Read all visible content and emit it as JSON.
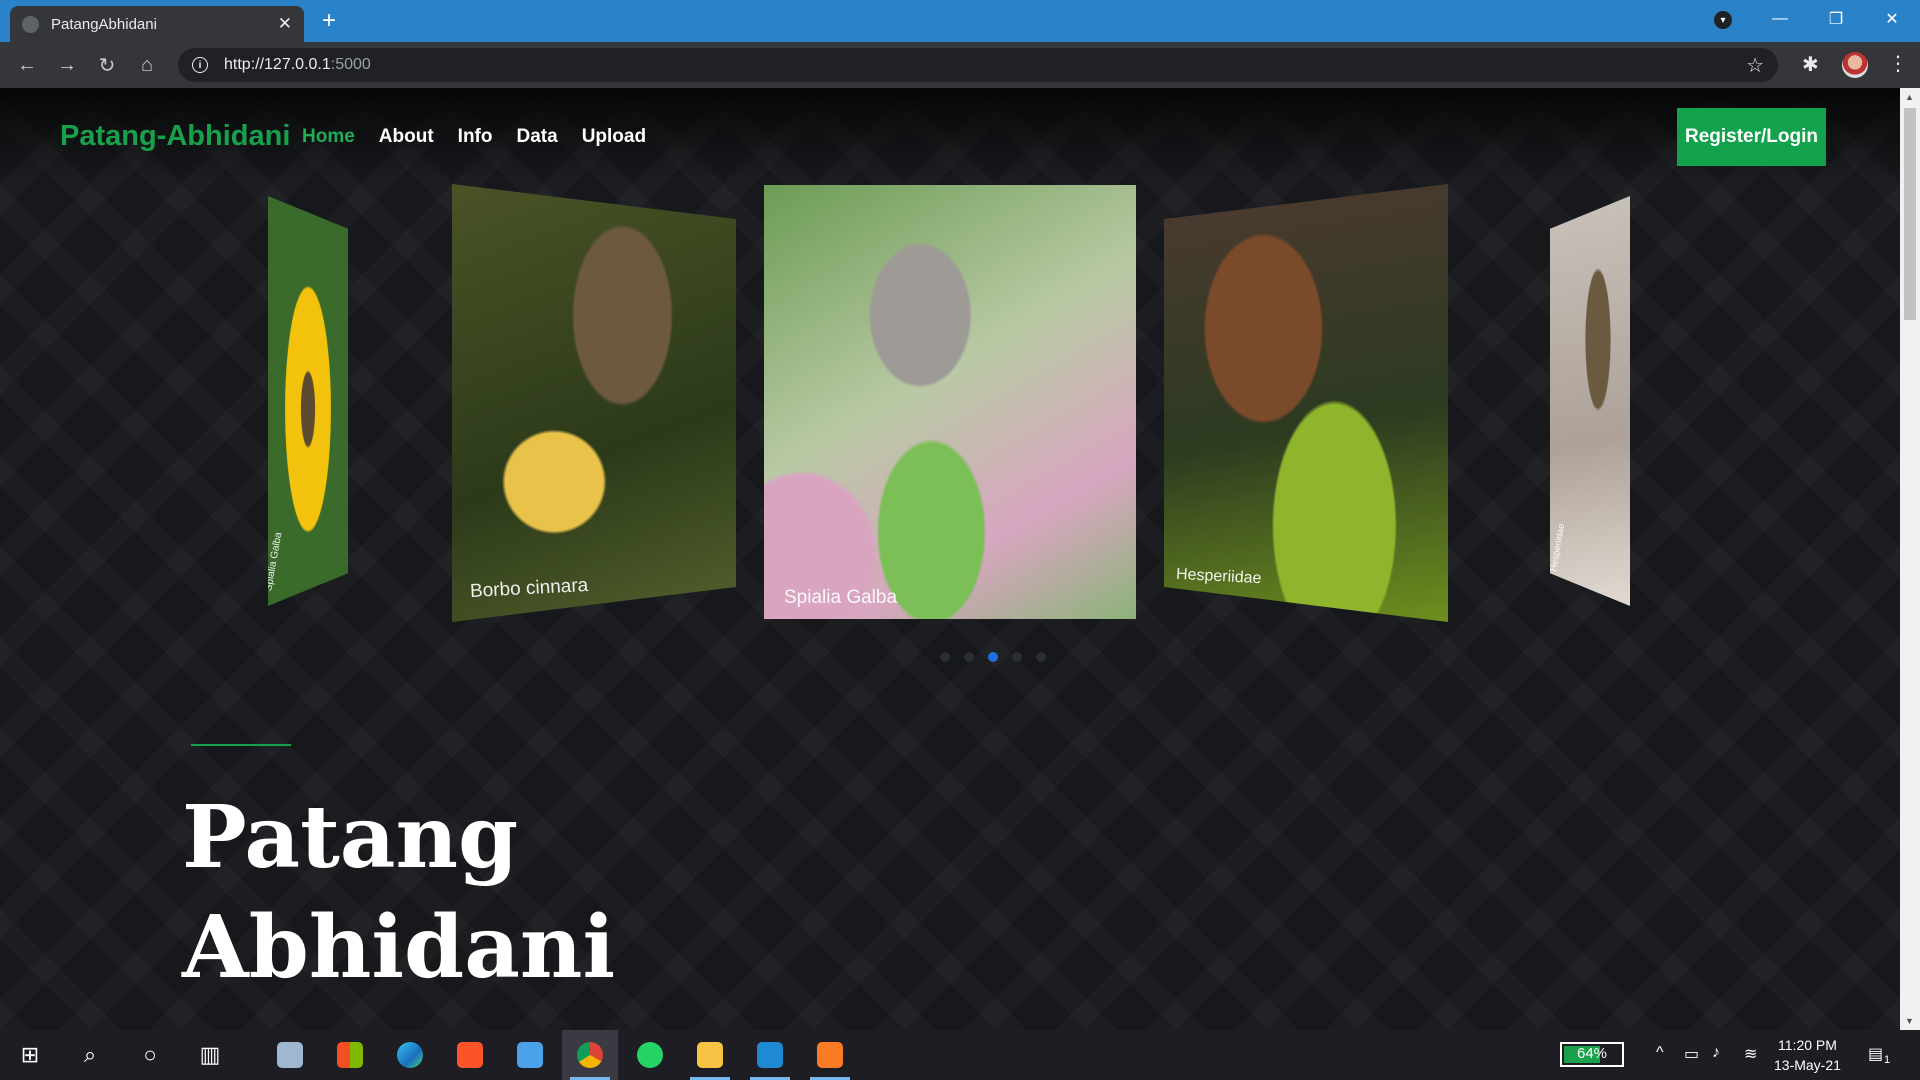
{
  "browser": {
    "tab_title": "PatangAbhidani",
    "url_host": "http://127.0.0.1",
    "url_port": ":5000"
  },
  "site": {
    "brand": "Patang-Abhidani",
    "nav": [
      "Home",
      "About",
      "Info",
      "Data",
      "Upload"
    ],
    "active_nav": "Home",
    "register_label": "Register/Login",
    "accent_color": "#12a24b"
  },
  "carousel": {
    "slides": [
      {
        "caption": "Spialia Galba",
        "position": "far-left"
      },
      {
        "caption": "Borbo cinnara",
        "position": "left"
      },
      {
        "caption": "Spialia Galba",
        "position": "center"
      },
      {
        "caption": "Hesperiidae",
        "position": "right"
      },
      {
        "caption": "Hesperiidae",
        "position": "far-right"
      }
    ],
    "active_dot_index": 2,
    "dot_count": 5
  },
  "hero": {
    "line1": "Patang",
    "line2": "Abhidani"
  },
  "taskbar": {
    "battery_percent": "64%",
    "time": "11:20 PM",
    "date": "13-May-21",
    "notifications": "1"
  }
}
